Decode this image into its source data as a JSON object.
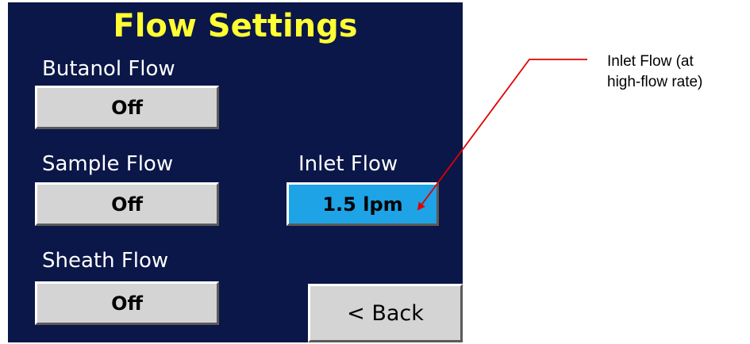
{
  "panel": {
    "title": "Flow Settings",
    "background_color": "#0b1748",
    "title_color": "#ffff33"
  },
  "controls": {
    "butanol": {
      "label": "Butanol Flow",
      "value": "Off"
    },
    "sample": {
      "label": "Sample Flow",
      "value": "Off"
    },
    "sheath": {
      "label": "Sheath Flow",
      "value": "Off"
    },
    "inlet": {
      "label": "Inlet Flow",
      "value": "1.5 lpm",
      "button_color": "#1ea3e6"
    },
    "back": {
      "label": "< Back"
    }
  },
  "annotation": {
    "line1": "Inlet Flow (at",
    "line2": "high-flow rate)",
    "arrow_color": "#e00000"
  }
}
